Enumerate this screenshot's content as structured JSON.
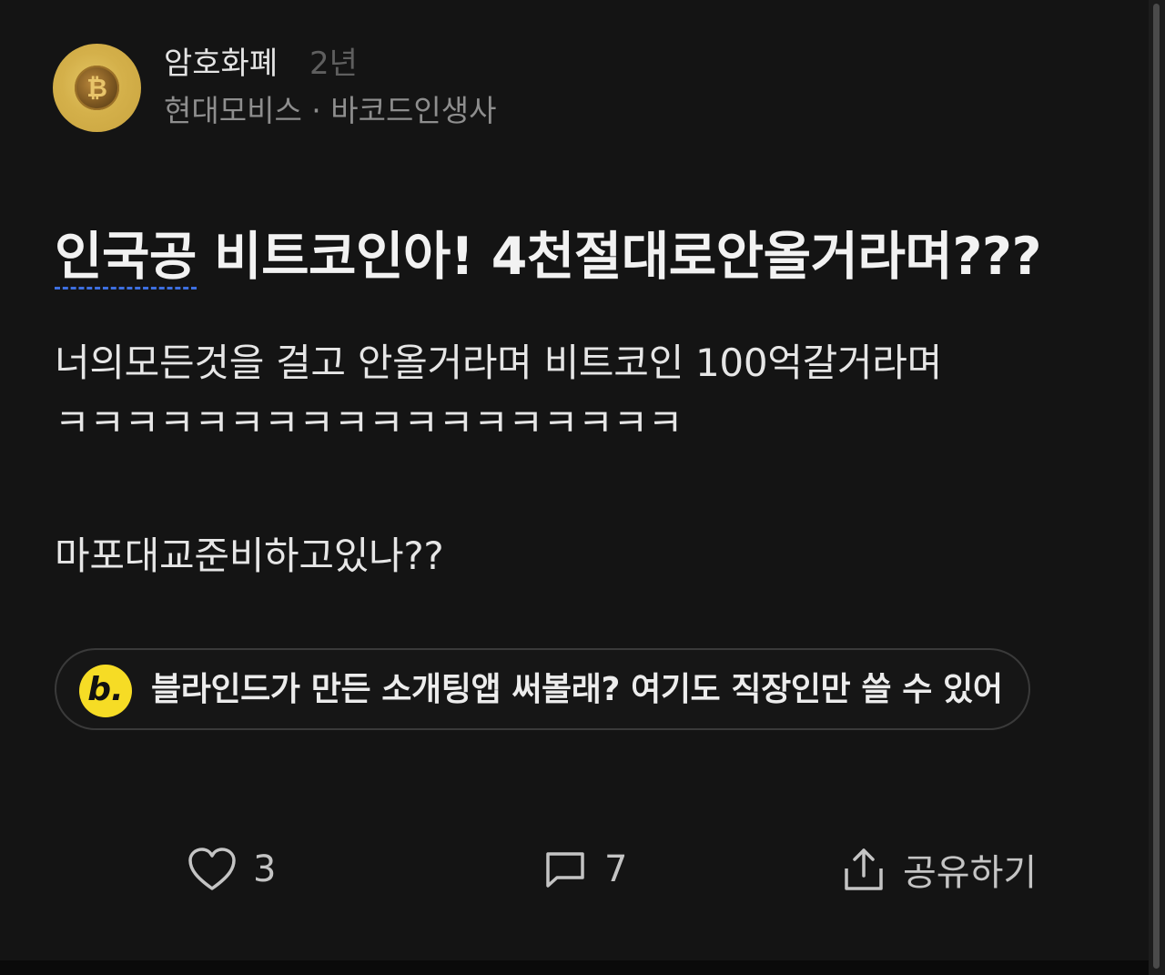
{
  "author": {
    "name": "암호화폐",
    "age": "2년",
    "company_line": "현대모비스 · 바코드인생사",
    "avatar_icon": "bitcoin-coin-icon"
  },
  "post": {
    "title_part1": "인국공",
    "title_part2": " 비트코인아! 4천절대로안올거라며???",
    "body_lines": [
      "너의모든것을 걸고 안올거라며 비트코인 100억갈거라며",
      "ㅋㅋㅋㅋㅋㅋㅋㅋㅋㅋㅋㅋㅋㅋㅋㅋㅋㅋ",
      "마포대교준비하고있나??"
    ]
  },
  "promo": {
    "logo_letter": "b.",
    "text": "블라인드가 만든 소개팅앱 써볼래? 여기도 직장인만 쓸 수 있어"
  },
  "actions": {
    "like_count": "3",
    "comment_count": "7",
    "share_label": "공유하기"
  },
  "colors": {
    "background": "#141414",
    "promo_logo": "#f6dc25",
    "avatar_gold": "#d4b04a",
    "spellcheck_underline": "#3d6fe0"
  }
}
